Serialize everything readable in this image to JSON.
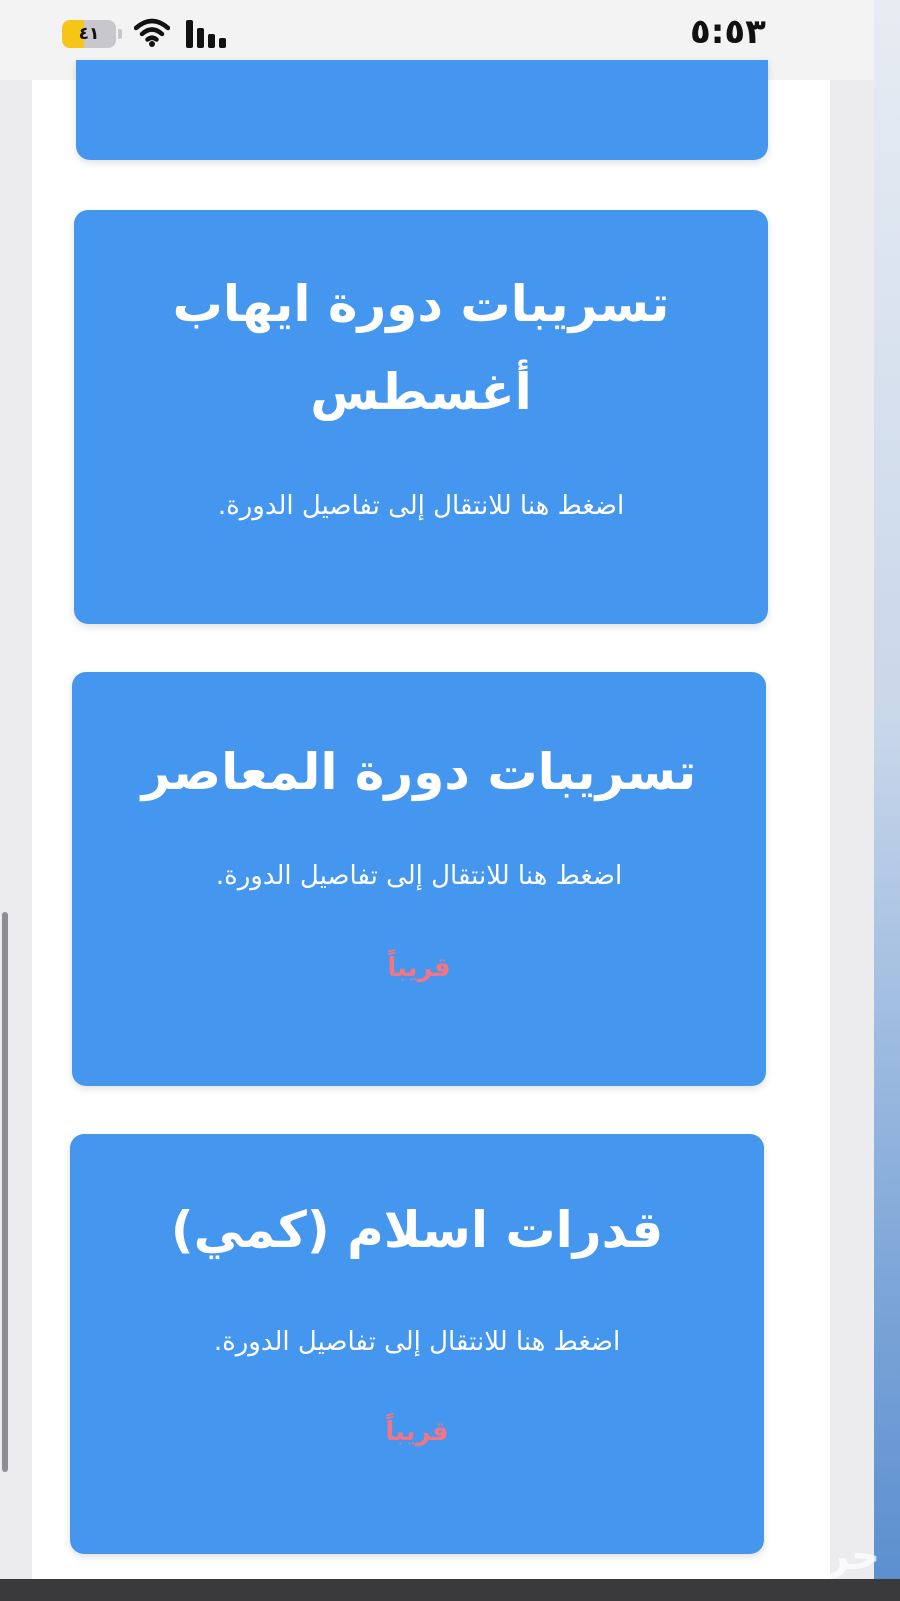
{
  "status_bar": {
    "time": "٥:٥٣",
    "battery_level": "٤١",
    "battery_fraction": 0.41,
    "battery_color": "#f5c518",
    "icons": [
      "battery-icon",
      "wifi-icon",
      "signal-icon"
    ]
  },
  "cards": [
    {
      "title": "",
      "subtitle": "",
      "badge": ""
    },
    {
      "title": "تسريبات دورة ايهاب أغسطس",
      "subtitle": "اضغط هنا للانتقال إلى تفاصيل الدورة.",
      "badge": ""
    },
    {
      "title": "تسريبات دورة المعاصر",
      "subtitle": "اضغط هنا للانتقال إلى تفاصيل الدورة.",
      "badge": "قريباً"
    },
    {
      "title": "قدرات اسلام (كمي)",
      "subtitle": "اضغط هنا للانتقال إلى تفاصيل الدورة.",
      "badge": "قريباً"
    }
  ],
  "colors": {
    "card_background": "#4596ef",
    "card_text": "#ffffff",
    "badge_text": "#f07585",
    "page_background": "#ffffff"
  },
  "watermark": "حراج"
}
